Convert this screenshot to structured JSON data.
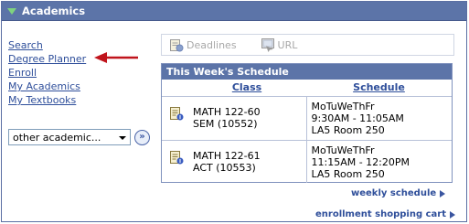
{
  "header": {
    "title": "Academics"
  },
  "nav": {
    "items": [
      "Search",
      "Degree Planner",
      "Enroll",
      "My Academics",
      "My Textbooks"
    ]
  },
  "dropdown": {
    "selected": "other academic..."
  },
  "tabs": [
    {
      "label": "Deadlines",
      "icon": "deadlines-icon"
    },
    {
      "label": "URL",
      "icon": "url-icon"
    }
  ],
  "schedule": {
    "title": "This Week's Schedule",
    "columns": [
      "Class",
      "Schedule"
    ],
    "rows": [
      {
        "class_line1": "MATH 122-60",
        "class_line2": "SEM (10552)",
        "days": "MoTuWeThFr",
        "time": "9:30AM - 11:05AM",
        "room": "LA5  Room 250"
      },
      {
        "class_line1": "MATH 122-61",
        "class_line2": "ACT (10553)",
        "days": "MoTuWeThFr",
        "time": "11:15AM - 12:20PM",
        "room": "LA5  Room 250"
      }
    ]
  },
  "links": {
    "weekly": "weekly schedule",
    "cart": "enrollment shopping cart"
  },
  "colors": {
    "header": "#5c74a8",
    "link": "#2e4e9a",
    "arrow": "#c0141c"
  }
}
